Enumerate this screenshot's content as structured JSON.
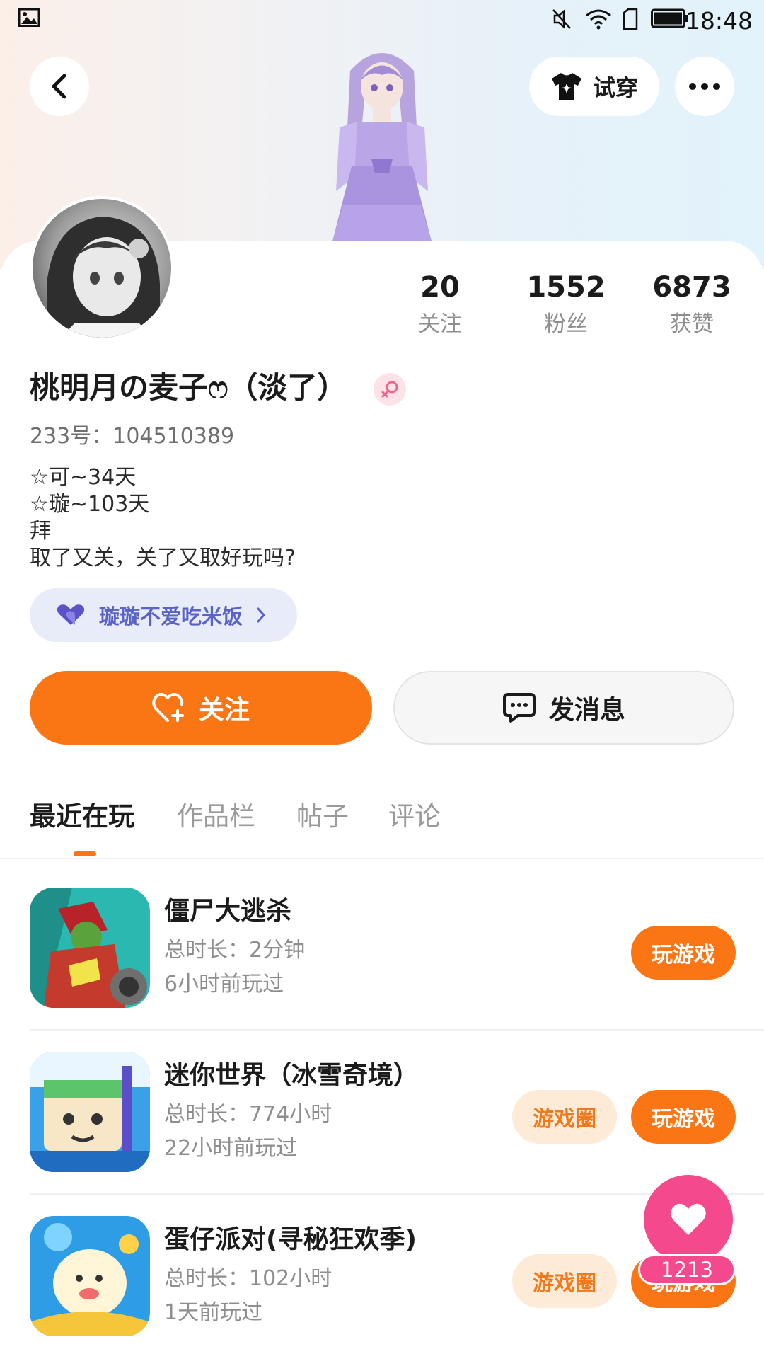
{
  "status_bar": {
    "time": "18:48",
    "icons": [
      "gallery-icon",
      "mute-icon",
      "wifi-icon",
      "sim-icon",
      "battery-icon"
    ]
  },
  "header": {
    "back_icon": "chevron-left-icon",
    "try_on_label": "试穿",
    "try_on_icon": "shirt-icon",
    "more_icon": "more-dots-icon"
  },
  "profile": {
    "stats": [
      {
        "value": "20",
        "label": "关注"
      },
      {
        "value": "1552",
        "label": "粉丝"
      },
      {
        "value": "6873",
        "label": "获赞"
      }
    ],
    "nickname": "桃明月の麦子ෆ（淡了）",
    "gender_icon": "female-icon",
    "user_id": "233号：104510389",
    "bio_lines": [
      "☆可~34天",
      "☆璇~103天",
      "拜",
      "取了又关，关了又取好玩吗?"
    ],
    "cp_tag": {
      "label": "璇璇不爱吃米饭",
      "icon": "double-heart-icon"
    }
  },
  "actions": {
    "follow_label": "关注",
    "message_label": "发消息"
  },
  "tabs": [
    {
      "label": "最近在玩",
      "active": true
    },
    {
      "label": "作品栏",
      "active": false
    },
    {
      "label": "帖子",
      "active": false
    },
    {
      "label": "评论",
      "active": false
    }
  ],
  "games": [
    {
      "title": "僵尸大逃杀",
      "duration": "总时长：2分钟",
      "last_played": "6小时前玩过",
      "play_label": "玩游戏"
    },
    {
      "title": "迷你世界（冰雪奇境）",
      "duration": "总时长：774小时",
      "last_played": "22小时前玩过",
      "circle_label": "游戏圈",
      "play_label": "玩游戏"
    },
    {
      "title": "蛋仔派对(寻秘狂欢季)",
      "duration": "总时长：102小时",
      "last_played": "1天前玩过",
      "circle_label": "游戏圈",
      "play_label": "玩游戏"
    }
  ],
  "floating_like": {
    "count": "1213"
  },
  "colors": {
    "accent": "#fa7614",
    "pink": "#f5498d",
    "cp_tag_bg": "#e8ecf8",
    "cp_tag_text": "#5a63c8"
  }
}
